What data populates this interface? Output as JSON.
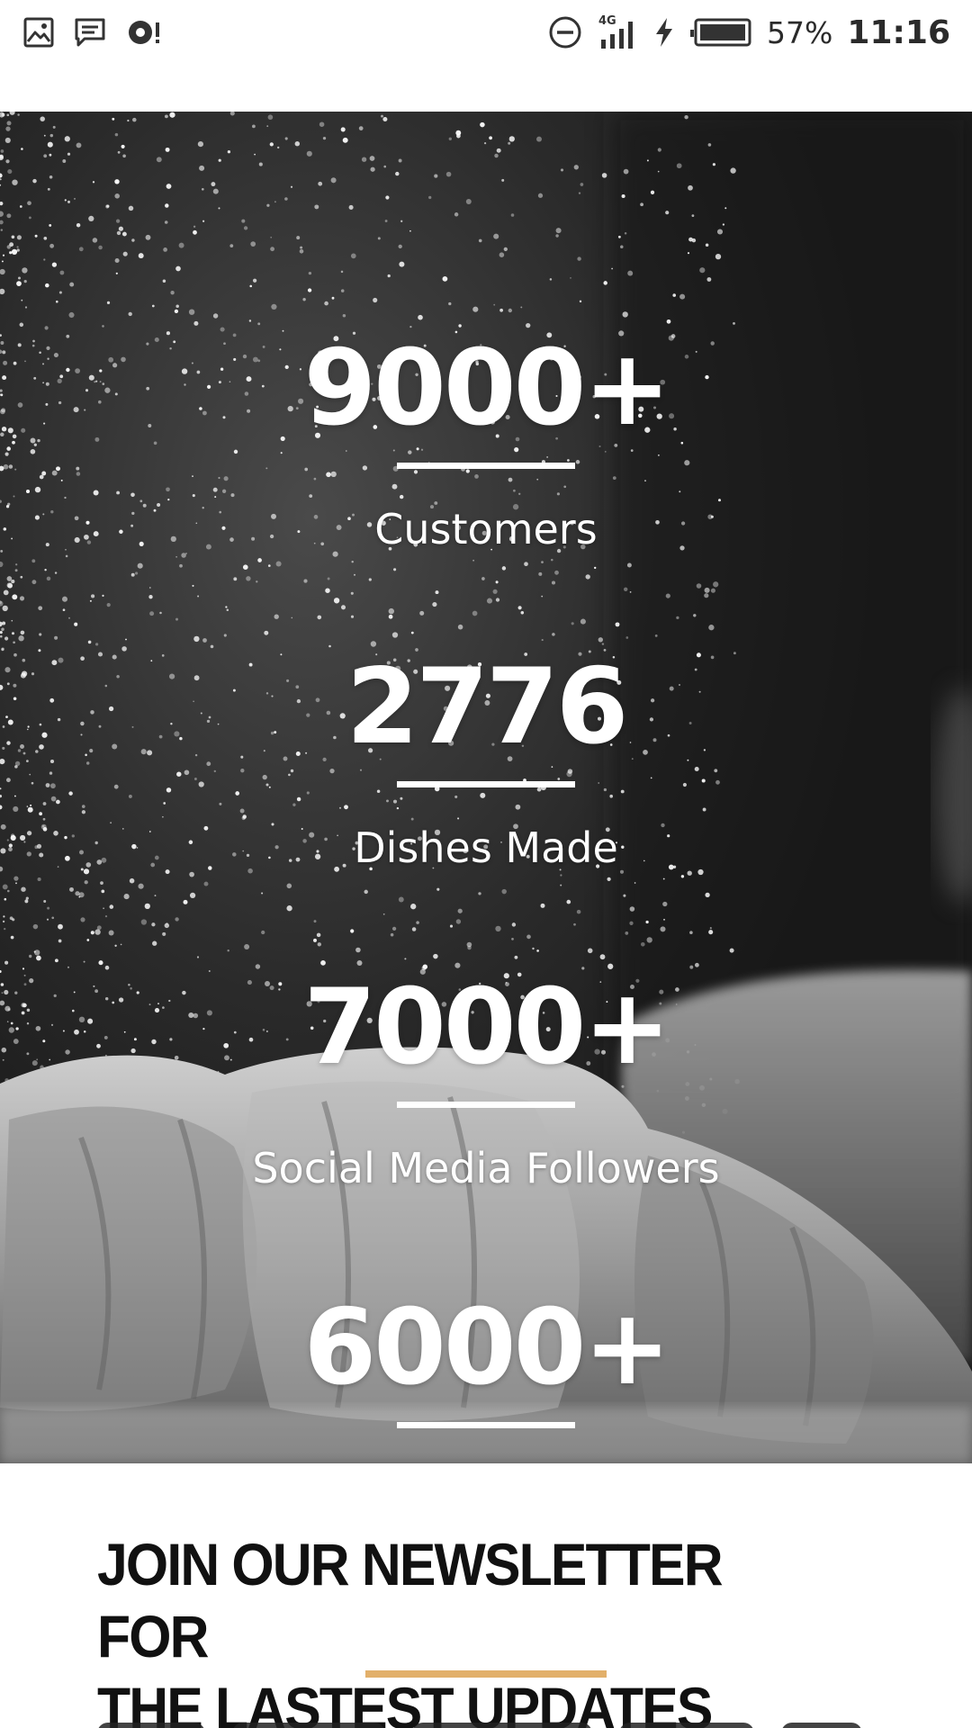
{
  "status_bar": {
    "left_icons": [
      "gallery-icon",
      "message-icon",
      "sync-alert-icon"
    ],
    "right_icons": [
      "do-not-disturb-icon",
      "signal-4g-icon",
      "charging-bolt-icon",
      "battery-icon"
    ],
    "network": "4G",
    "battery_percent": "57%",
    "time": "11:16"
  },
  "stats": [
    {
      "value": "9000+",
      "label": "Customers"
    },
    {
      "value": "2776",
      "label": "Dishes Made"
    },
    {
      "value": "7000+",
      "label": "Social Media Followers"
    },
    {
      "value": "6000+",
      "label": ""
    }
  ],
  "newsletter": {
    "title_line1": "JOIN OUR NEWSLETTER FOR",
    "title_line2": "THE LASTEST UPDATES"
  },
  "colors": {
    "accent_underline": "#e2b06a",
    "stat_text": "#ffffff",
    "heading_text": "#111111"
  }
}
